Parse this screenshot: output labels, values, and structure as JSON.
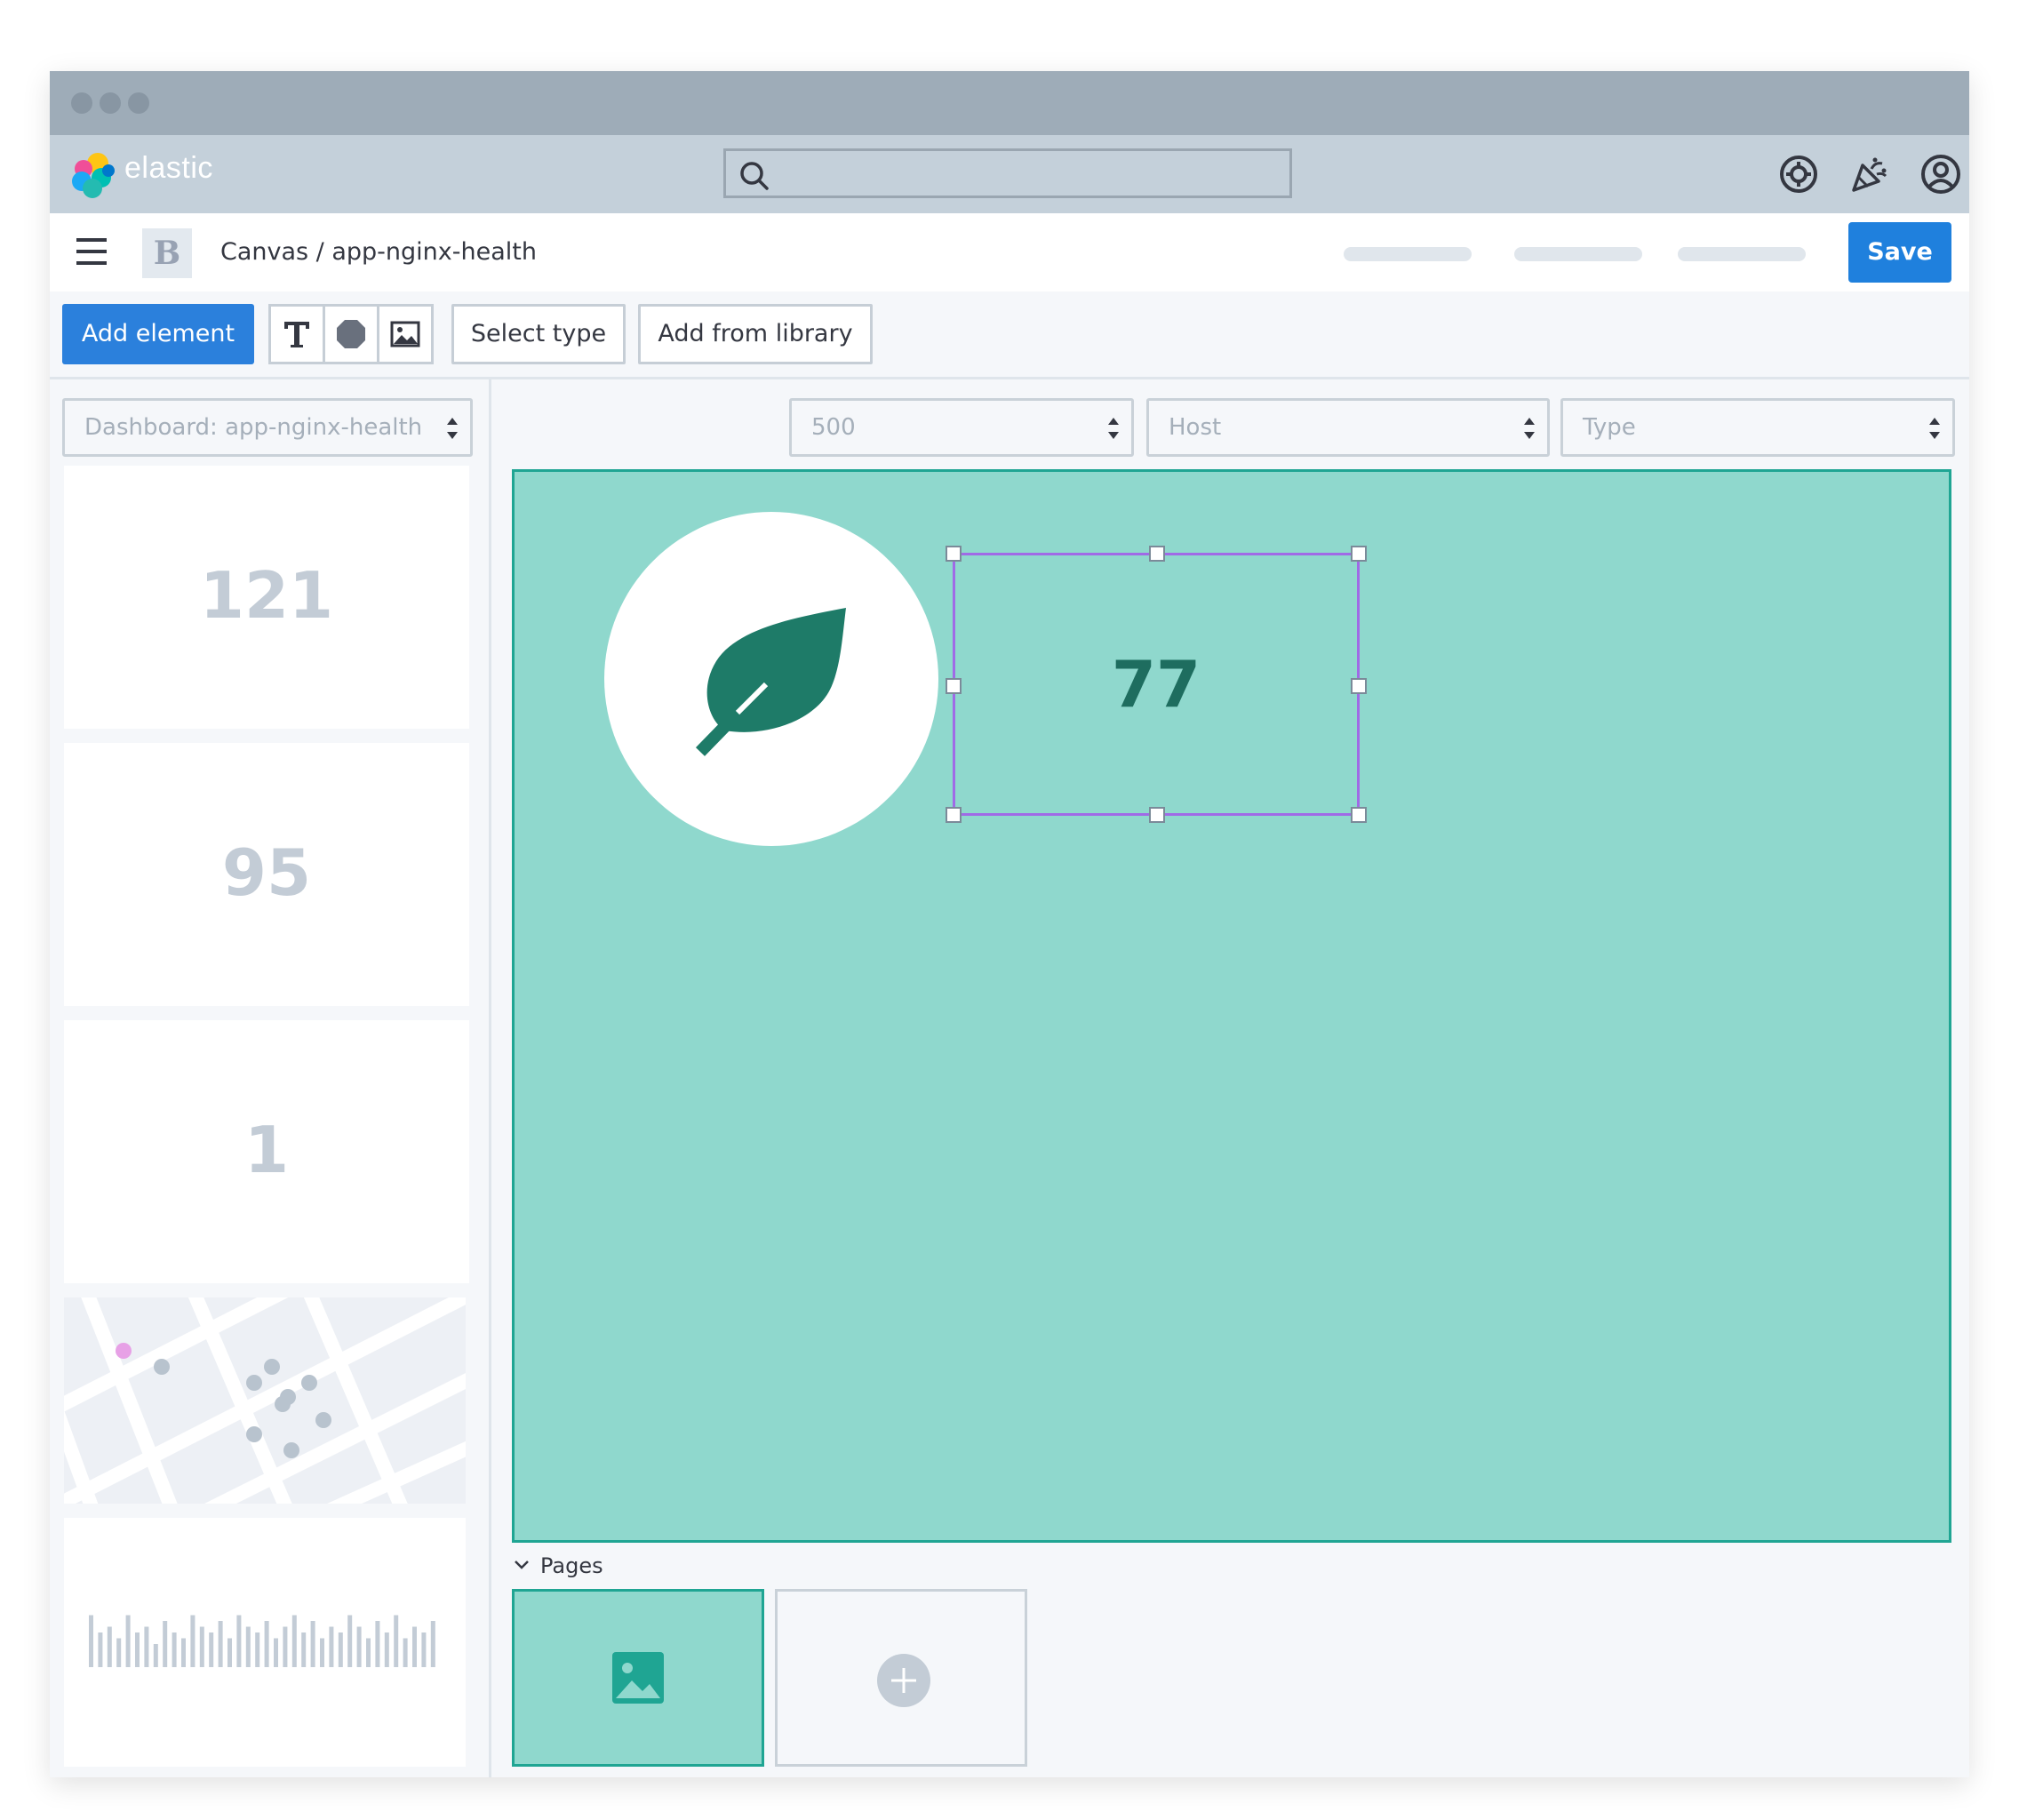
{
  "header": {
    "logo_text": "elastic",
    "search": {
      "placeholder": ""
    },
    "icons": [
      "help-icon",
      "news-feed-icon",
      "user-account-icon"
    ]
  },
  "breadcrumb": {
    "badge": "B",
    "path": "Canvas / app-nginx-health"
  },
  "toolbar": {
    "save_label": "Save",
    "add_element_label": "Add element",
    "tools": [
      "text-tool-icon",
      "shape-tool-icon",
      "image-tool-icon"
    ],
    "select_type_label": "Select type",
    "add_from_library_label": "Add from library"
  },
  "sidebar": {
    "dashboard_select": "Dashboard: app-nginx-health",
    "cards": [
      {
        "value": "121"
      },
      {
        "value": "95"
      },
      {
        "value": "1"
      }
    ],
    "bar_chart_values": [
      9,
      6,
      7,
      5,
      9,
      6,
      7,
      4,
      8,
      6,
      5,
      9,
      7,
      6,
      8,
      5,
      9,
      7,
      6,
      8,
      5,
      7,
      9,
      6,
      8,
      5,
      7,
      6,
      9,
      7,
      5,
      8,
      6,
      9,
      5,
      7,
      6,
      8
    ]
  },
  "filters": {
    "limit": "500",
    "host": "Host",
    "type": "Type"
  },
  "workpad": {
    "selected_metric": "77",
    "leaf_icon": "leaf-icon"
  },
  "pages": {
    "label": "Pages"
  },
  "colors": {
    "accent": "#2b80dc",
    "canvas_bg": "#8fd8cd",
    "canvas_border": "#1fa593",
    "metric_text": "#1e6d5f",
    "selection": "#a06ae6"
  }
}
